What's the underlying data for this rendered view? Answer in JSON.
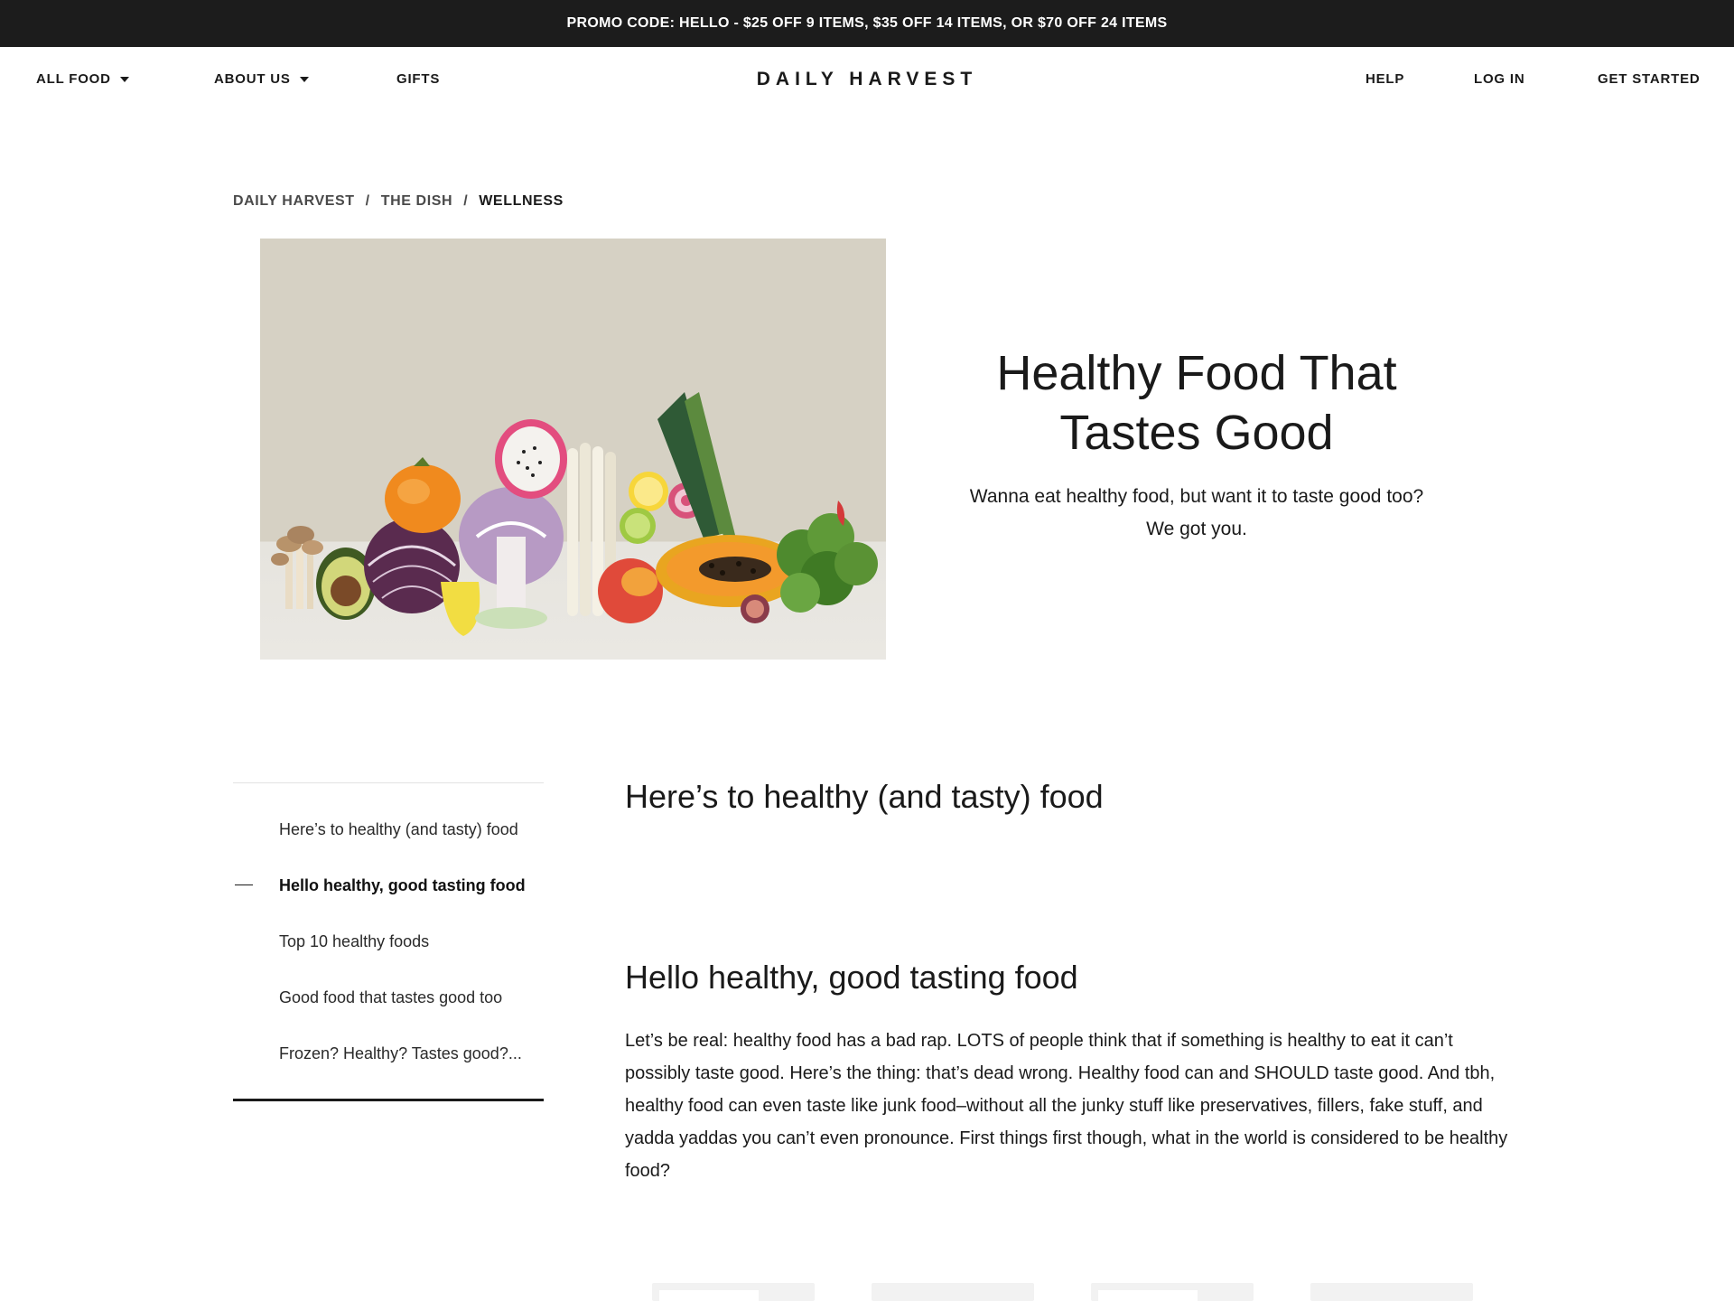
{
  "promo": {
    "text": "PROMO CODE: HELLO - $25 OFF 9 ITEMS, $35 OFF 14 ITEMS, OR $70 OFF 24 ITEMS"
  },
  "nav": {
    "all_food": "ALL FOOD",
    "about_us": "ABOUT US",
    "gifts": "GIFTS",
    "logo": "DAILY HARVEST",
    "help": "HELP",
    "log_in": "LOG IN",
    "get_started": "GET STARTED"
  },
  "breadcrumb": {
    "items": [
      "DAILY HARVEST",
      "THE DISH",
      "WELLNESS"
    ],
    "separator": "/"
  },
  "hero": {
    "title": "Healthy Food That Tastes Good",
    "subtitle": "Wanna eat healthy food, but want it to taste good too? We got you."
  },
  "toc": {
    "items": [
      "Here’s to healthy (and tasty) food",
      "Hello healthy, good tasting food",
      "Top 10 healthy foods",
      "Good food that tastes good too",
      "Frozen? Healthy? Tastes good?..."
    ],
    "active_index": 1
  },
  "article": {
    "heading1": "Here’s to healthy (and tasty) food",
    "heading2": "Hello healthy, good tasting food",
    "paragraph": "Let’s be real: healthy food has a bad rap. LOTS of people think that if something is healthy to eat it can’t possibly taste good. Here’s the thing: that’s dead wrong. Healthy food can and SHOULD taste good. And tbh, healthy food can even taste like junk food–without all the junky stuff like preservatives, fillers, fake stuff, and yadda yaddas you can’t even pronounce. First things first though, what in the world is considered to be healthy food?"
  },
  "colors": {
    "promo_bg": "#1c1c1c",
    "text": "#1a1a1a",
    "image_bg": "#d6d1c4"
  }
}
